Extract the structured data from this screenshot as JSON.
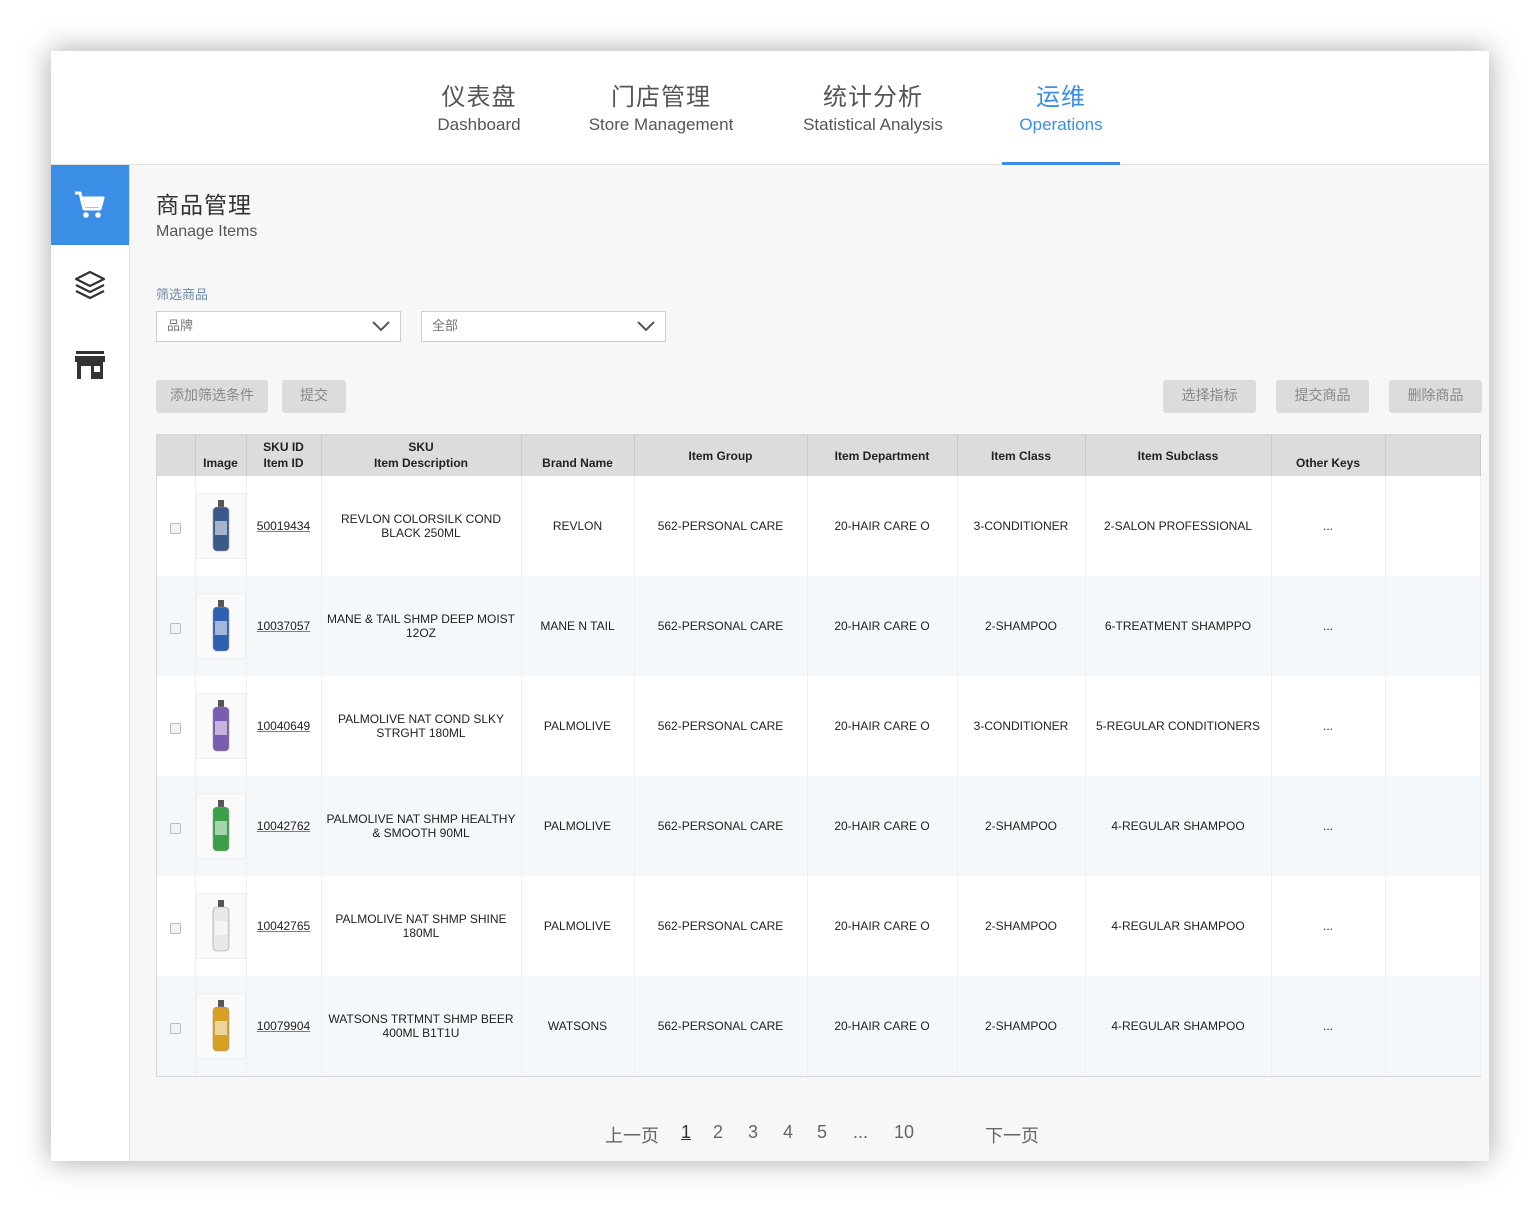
{
  "nav": {
    "tabs": [
      {
        "zh": "仪表盘",
        "en": "Dashboard",
        "active": false
      },
      {
        "zh": "门店管理",
        "en": "Store Management",
        "active": false
      },
      {
        "zh": "统计分析",
        "en": "Statistical Analysis",
        "active": false
      },
      {
        "zh": "运维",
        "en": "Operations",
        "active": true
      }
    ]
  },
  "sidebar": {
    "items": [
      {
        "icon": "shopping-cart-icon",
        "active": true
      },
      {
        "icon": "layers-icon",
        "active": false
      },
      {
        "icon": "store-icon",
        "active": false
      }
    ]
  },
  "page": {
    "title": "商品管理",
    "subtitle": "Manage Items"
  },
  "filter": {
    "label": "筛选商品",
    "select1": "品牌",
    "select2": "全部",
    "add_filter": "添加筛选条件",
    "submit": "提交"
  },
  "actions": {
    "select_metrics": "选择指标",
    "submit_items": "提交商品",
    "delete_items": "删除商品"
  },
  "table": {
    "headers": {
      "image": "Image",
      "sku_id_1": "SKU ID",
      "sku_id_2": "Item ID",
      "sku_desc_1": "SKU",
      "sku_desc_2": "Item Description",
      "brand": "Brand Name",
      "group": "Item Group",
      "department": "Item Department",
      "class": "Item Class",
      "subclass": "Item Subclass",
      "other": "Other Keys"
    },
    "rows": [
      {
        "sku": "50019434",
        "desc": "REVLON COLORSILK COND BLACK 250ML",
        "brand": "REVLON",
        "group": "562-PERSONAL CARE",
        "department": "20-HAIR CARE O",
        "class": "3-CONDITIONER",
        "subclass": "2-SALON PROFESSIONAL",
        "other": "...",
        "thumb_color": "#3a5a8c"
      },
      {
        "sku": "10037057",
        "desc": "MANE & TAIL SHMP DEEP MOIST 12OZ",
        "brand": "MANE N TAIL",
        "group": "562-PERSONAL CARE",
        "department": "20-HAIR CARE O",
        "class": "2-SHAMPOO",
        "subclass": "6-TREATMENT SHAMPPO",
        "other": "...",
        "thumb_color": "#2f5fb0"
      },
      {
        "sku": "10040649",
        "desc": "PALMOLIVE NAT COND SLKY STRGHT 180ML",
        "brand": "PALMOLIVE",
        "group": "562-PERSONAL CARE",
        "department": "20-HAIR CARE O",
        "class": "3-CONDITIONER",
        "subclass": "5-REGULAR CONDITIONERS",
        "other": "...",
        "thumb_color": "#7a5cb0"
      },
      {
        "sku": "10042762",
        "desc": "PALMOLIVE NAT SHMP HEALTHY & SMOOTH 90ML",
        "brand": "PALMOLIVE",
        "group": "562-PERSONAL CARE",
        "department": "20-HAIR CARE O",
        "class": "2-SHAMPOO",
        "subclass": "4-REGULAR SHAMPOO",
        "other": "...",
        "thumb_color": "#3aa048"
      },
      {
        "sku": "10042765",
        "desc": "PALMOLIVE NAT SHMP SHINE 180ML",
        "brand": "PALMOLIVE",
        "group": "562-PERSONAL CARE",
        "department": "20-HAIR CARE O",
        "class": "2-SHAMPOO",
        "subclass": "4-REGULAR SHAMPOO",
        "other": "...",
        "thumb_color": "#e8e8e8"
      },
      {
        "sku": "10079904",
        "desc": "WATSONS TRTMNT SHMP BEER 400ML B1T1U",
        "brand": "WATSONS",
        "group": "562-PERSONAL CARE",
        "department": "20-HAIR CARE O",
        "class": "2-SHAMPOO",
        "subclass": "4-REGULAR SHAMPOO",
        "other": "...",
        "thumb_color": "#d8a020"
      }
    ]
  },
  "pager": {
    "prev": "上一页",
    "pages": [
      "1",
      "2",
      "3",
      "4",
      "5"
    ],
    "ellipsis": "...",
    "last": "10",
    "next": "下一页",
    "current": "1"
  },
  "colors": {
    "accent": "#3a8ee6",
    "header_bg": "#dcdcdc",
    "button_bg": "#dcdcdc"
  }
}
